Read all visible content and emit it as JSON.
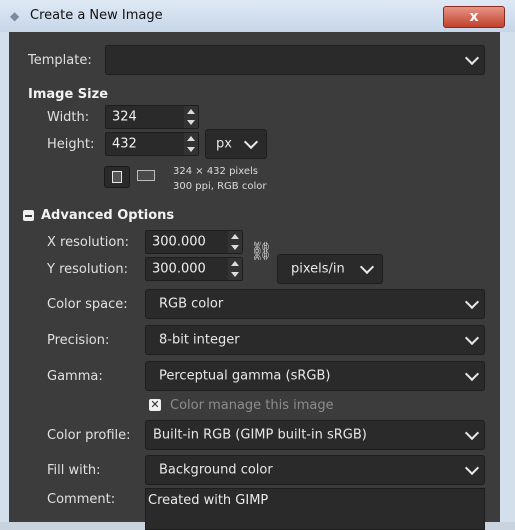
{
  "window": {
    "title": "Create a New Image",
    "close_label": "x"
  },
  "template": {
    "label": "Template:",
    "value": ""
  },
  "image_size": {
    "heading": "Image Size",
    "width_label": "Width:",
    "width_value": "324",
    "height_label": "Height:",
    "height_value": "432",
    "unit": "px",
    "info_line1": "324 × 432 pixels",
    "info_line2": "300 ppi, RGB color"
  },
  "advanced": {
    "heading": "Advanced Options",
    "x_res_label": "X resolution:",
    "x_res_value": "300.000",
    "y_res_label": "Y resolution:",
    "y_res_value": "300.000",
    "res_unit": "pixels/in",
    "color_space_label": "Color space:",
    "color_space_value": "RGB color",
    "precision_label": "Precision:",
    "precision_value": "8-bit integer",
    "gamma_label": "Gamma:",
    "gamma_value": "Perceptual gamma (sRGB)",
    "color_manage_label": "Color manage this image",
    "color_profile_label": "Color profile:",
    "color_profile_value": "Built-in RGB (GIMP built-in sRGB)",
    "fill_label": "Fill with:",
    "fill_value": "Background color",
    "comment_label": "Comment:",
    "comment_value": "Created with GIMP"
  }
}
